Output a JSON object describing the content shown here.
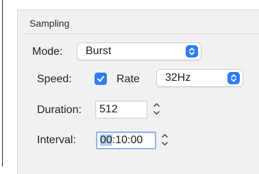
{
  "group": {
    "title": "Sampling"
  },
  "mode": {
    "label": "Mode:",
    "value": "Burst"
  },
  "speed": {
    "label": "Speed:",
    "rate_label": "Rate",
    "rate_checked": true,
    "rate_value": "32Hz"
  },
  "duration": {
    "label": "Duration:",
    "value": "512"
  },
  "interval": {
    "label": "Interval:",
    "hours": "00",
    "rest": ":10:00"
  },
  "colors": {
    "accent": "#2f7cf6",
    "selection": "#b9d2f8",
    "panel": "#f1f1f1"
  },
  "icons": {
    "popup_chevron": "chevron-up-down-icon",
    "checkmark": "checkmark-icon",
    "stepper": "stepper-arrows-icon"
  }
}
